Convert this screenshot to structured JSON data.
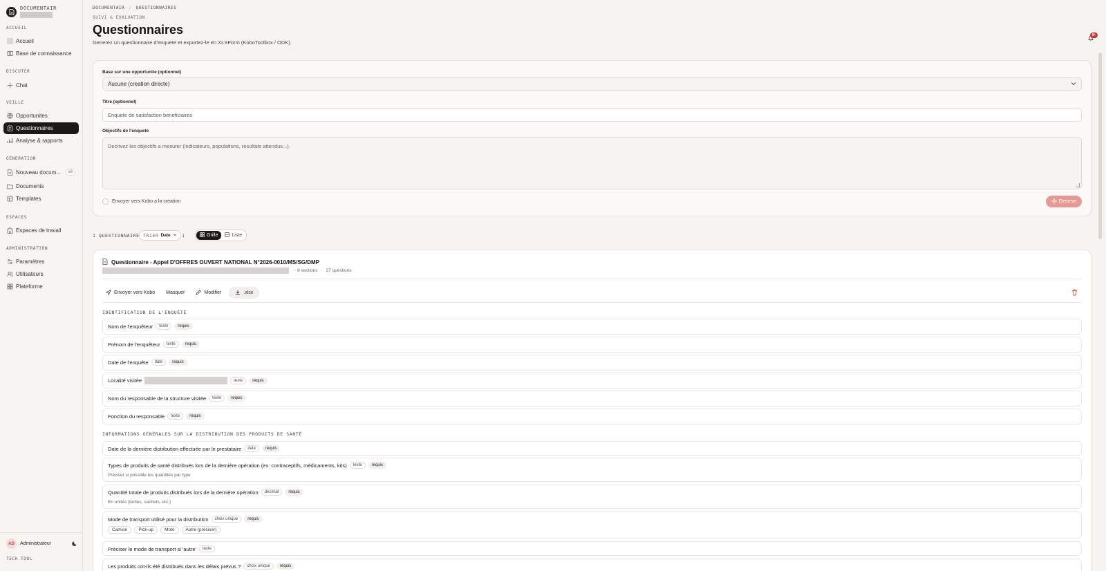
{
  "brand": {
    "name": "DOCUMENTAIR"
  },
  "sidebar": {
    "sections": [
      {
        "title": "ACCUEIL",
        "items": [
          {
            "label": "Accueil"
          },
          {
            "label": "Base de connaissance"
          }
        ]
      },
      {
        "title": "DISCUTER",
        "items": [
          {
            "label": "Chat"
          }
        ]
      },
      {
        "title": "VEILLE",
        "items": [
          {
            "label": "Opportunites"
          },
          {
            "label": "Questionnaires"
          },
          {
            "label": "Analyse & rapports"
          }
        ]
      },
      {
        "title": "GENERATION",
        "items": [
          {
            "label": "Nouveau docum...",
            "badge": "v6"
          },
          {
            "label": "Documents"
          },
          {
            "label": "Templates"
          }
        ]
      },
      {
        "title": "ESPACES",
        "items": [
          {
            "label": "Espaces de travail"
          }
        ]
      },
      {
        "title": "ADMINISTRATION",
        "items": [
          {
            "label": "Paramètres"
          },
          {
            "label": "Utilisateurs"
          },
          {
            "label": "Plateforme"
          }
        ]
      }
    ],
    "active_item": "Questionnaires",
    "user": {
      "initials": "AD",
      "name": "Administrateur"
    },
    "footer_label": "TECH TOOL"
  },
  "header": {
    "breadcrumb": [
      "DOCUMENTAIR",
      "/",
      "QUESTIONNAIRES"
    ],
    "eyebrow": "SUIVI & EVALUATION",
    "title": "Questionnaires",
    "subtitle": "Generez un questionnaire d'enquete et exportez-le en XLSForm (KoboToolbox / ODK).",
    "notifications_badge": "9+"
  },
  "form": {
    "opportunity_label": "Base sur une opportunite (optionnel)",
    "opportunity_value": "Aucune (creation directe)",
    "title_label": "Titre (optionnel)",
    "title_placeholder": "Enquete de satisfaction beneficiaires",
    "objectives_label": "Objectifs de l'enquete",
    "objectives_placeholder": "Decrivez les objectifs a mesurer (indicateurs, populations, resultats attendus...).",
    "kobo_checkbox_label": "Envoyer vers Kobo a la creation",
    "generate_label": "Generer"
  },
  "toolbar": {
    "count_label": "1 QUESTIONNAIRE",
    "sort_key": "TRIER",
    "sort_value": "Date",
    "view_grid": "Grille",
    "view_list": "Liste",
    "active_view": "Grille"
  },
  "questionnaire": {
    "title": "Questionnaire - Appel D'OFFRES OUVERT NATIONAL N°2026-0010/MS/SG/DMP",
    "sections_count": "6 sections",
    "questions_count": "27 questions",
    "actions": {
      "send": "Envoyer vers Kobo",
      "hide": "Masquer",
      "edit": "Modifier",
      "export": ".xlsx"
    },
    "sections": [
      {
        "title": "IDENTIFICATION DE L'ENQUÊTÉ",
        "questions": [
          {
            "label": "Nom de l'enquêteur",
            "type": "texte",
            "required": "requis"
          },
          {
            "label": "Prénom de l'enquêteur",
            "type": "texte",
            "required": "requis"
          },
          {
            "label": "Date de l'enquête",
            "type": "date",
            "required": "requis"
          },
          {
            "label": "Localité visitée",
            "type": "texte",
            "required": "requis"
          },
          {
            "label": "Nom du responsable de la structure visitée",
            "type": "texte",
            "required": "requis"
          },
          {
            "label": "Fonction du responsable",
            "type": "texte",
            "required": "requis"
          }
        ]
      },
      {
        "title": "INFORMATIONS GÉNÉRALES SUR LA DISTRIBUTION DES PRODUITS DE SANTÉ",
        "questions": [
          {
            "label": "Date de la dernière distribution effectuée par le prestataire",
            "type": "date",
            "required": "requis"
          },
          {
            "label": "Types de produits de santé distribués lors de la dernière opération (ex: contraceptifs, médicaments, kits)",
            "type": "texte",
            "required": "requis",
            "hint": "Préciser si possible les quantités par type"
          },
          {
            "label": "Quantité totale de produits distribués lors de la dernière opération",
            "type": "decimal",
            "required": "requis",
            "hint": "En unités (boîtes, sachets, etc.)"
          },
          {
            "label": "Mode de transport utilisé pour la distribution",
            "type": "choix unique",
            "required": "requis",
            "options": [
              "Camion",
              "Pick-up",
              "Moto",
              "Autre (préciser)"
            ]
          },
          {
            "label": "Préciser le mode de transport si 'autre'",
            "type": "texte"
          },
          {
            "label": "Les produits ont-ils été distribués dans les délais prévus ?",
            "type": "choix unique",
            "required": "requis"
          }
        ]
      }
    ]
  }
}
